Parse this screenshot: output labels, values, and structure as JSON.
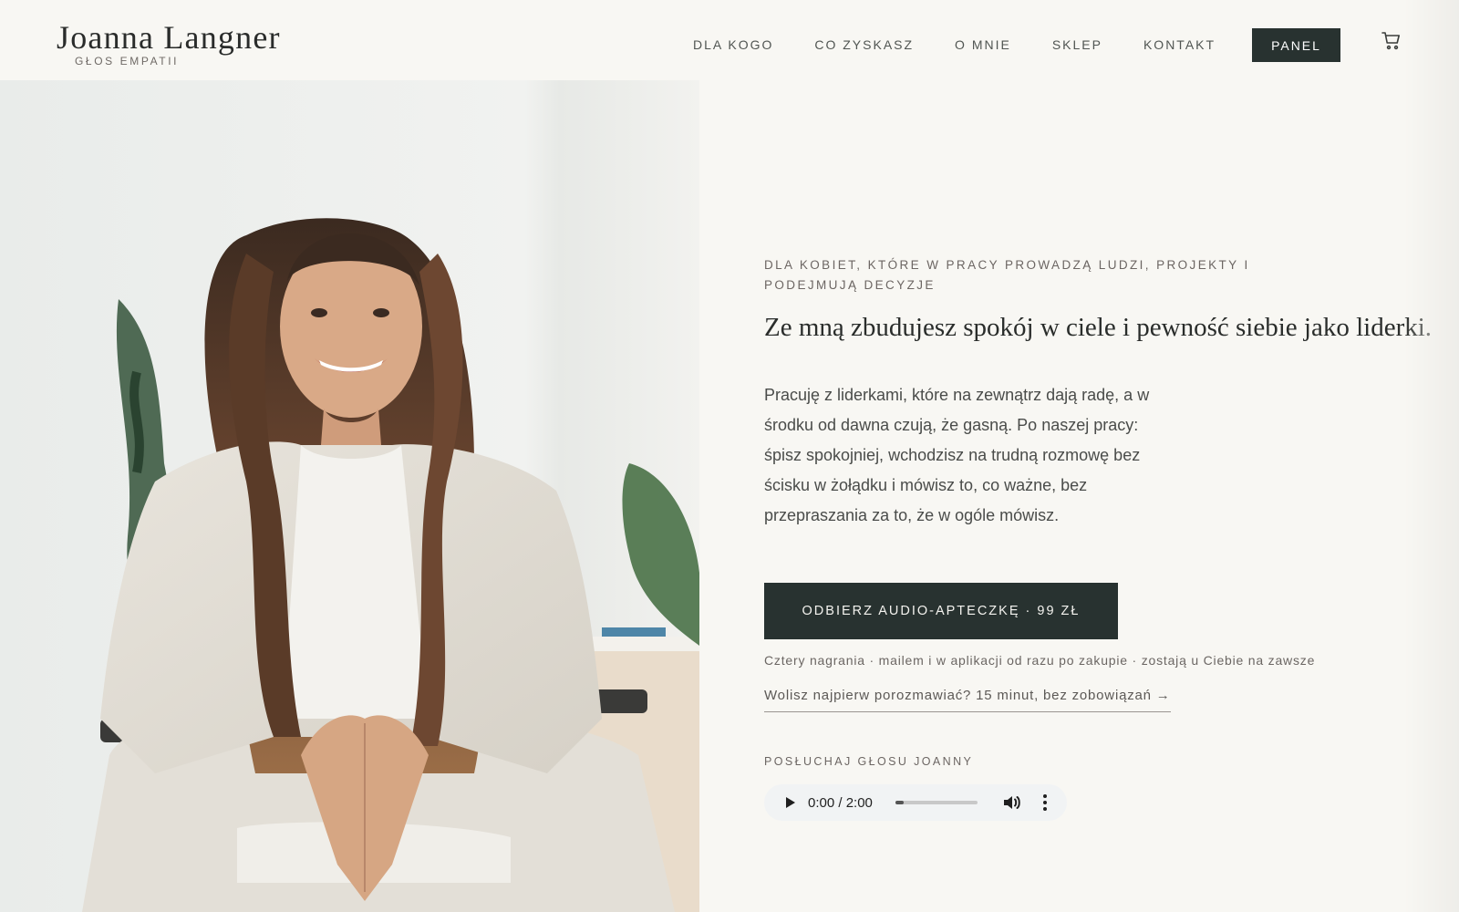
{
  "header": {
    "logo_name": "Joanna Langner",
    "logo_subtitle": "GŁOS EMPATII",
    "nav": [
      "DLA KOGO",
      "CO ZYSKASZ",
      "O MNIE",
      "SKLEP",
      "KONTAKT"
    ],
    "panel_label": "PANEL",
    "cart_icon": "cart-icon"
  },
  "hero": {
    "photo": "portrait of smiling woman in light linen suit sitting on chair",
    "eyebrow": "DLA KOBIET, KTÓRE W PRACY PROWADZĄ LUDZI, PROJEKTY I PODEJMUJĄ DECYZJE",
    "headline": "Ze mną zbudujesz spokój w ciele i pewność siebie jako liderki.",
    "lead": "Pracuję z liderkami, które na zewnątrz dają radę, a w środku od dawna czują, że gasną. Po naszej pracy: śpisz spokojniej, wchodzisz na trudną rozmowę bez ścisku w żołądku i mówisz to, co ważne, bez przepraszania za to, że w ogóle mówisz.",
    "cta_label": "ODBIERZ AUDIO-APTECZKĘ · 99 ZŁ",
    "cta_note": "Cztery nagrania · mailem i w aplikacji od razu po zakupie · zostają u Ciebie na zawsze",
    "talk_link": "Wolisz najpierw porozmawiać? 15 minut, bez zobowiązań →"
  },
  "audio": {
    "label": "POSŁUCHAJ GŁOSU JOANNY",
    "time": "0:00 / 2:00",
    "progress": 0.0
  },
  "colors": {
    "background": "#f8f7f3",
    "accent_dark": "#283230"
  }
}
